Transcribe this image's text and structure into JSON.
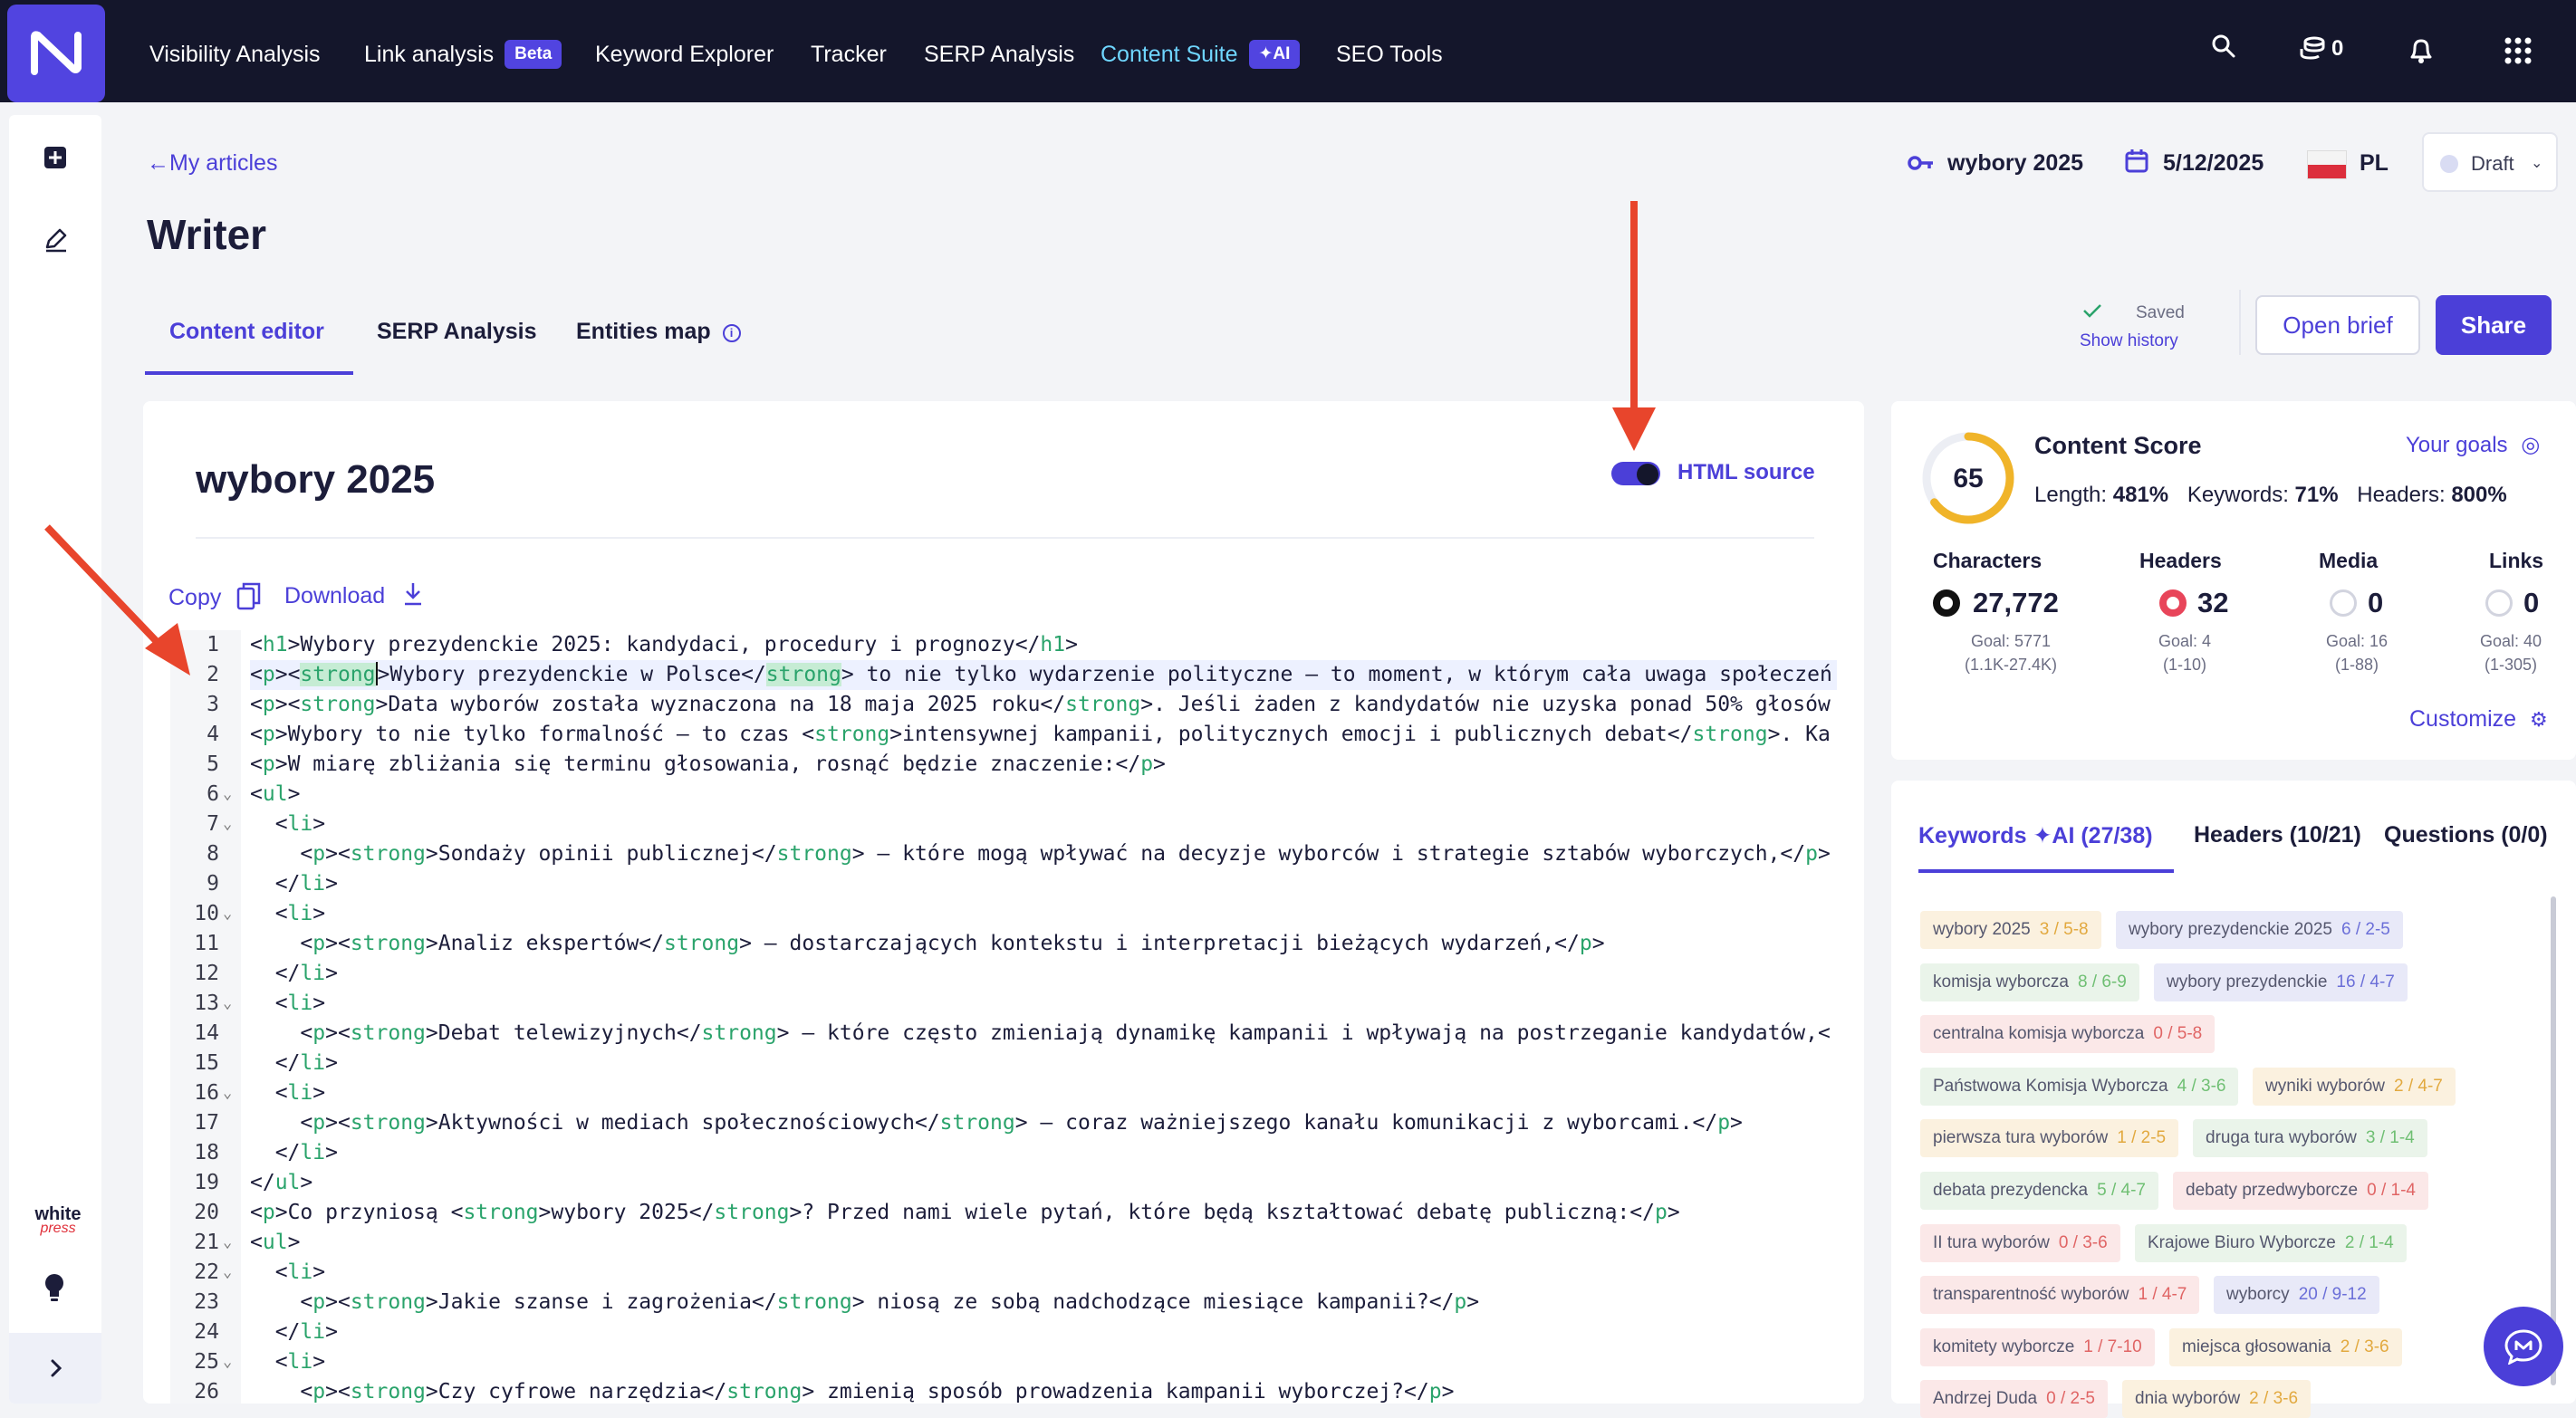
{
  "nav": {
    "items": [
      {
        "label": "Visibility Analysis"
      },
      {
        "label": "Link analysis",
        "badge": "Beta"
      },
      {
        "label": "Keyword Explorer"
      },
      {
        "label": "Tracker"
      },
      {
        "label": "SERP Analysis"
      },
      {
        "label": "Content Suite",
        "badge": "AI",
        "active": true
      },
      {
        "label": "SEO Tools"
      }
    ],
    "credits": "0",
    "icons": [
      "search-icon",
      "coins-icon",
      "bell-icon",
      "apps-grid-icon"
    ]
  },
  "sidebar": {
    "icons": [
      "add-square-icon",
      "edit-pen-icon",
      "lightbulb-icon",
      "chevron-right-icon"
    ],
    "partner_logo_top": "white",
    "partner_logo_bottom": "press"
  },
  "header": {
    "back_label": "My articles",
    "title": "Writer",
    "keyword": "wybory 2025",
    "date": "5/12/2025",
    "country": "PL",
    "status": "Draft"
  },
  "tabs": [
    {
      "label": "Content editor",
      "active": true
    },
    {
      "label": "SERP Analysis"
    },
    {
      "label": "Entities map"
    }
  ],
  "actions": {
    "saved": "Saved",
    "show_history": "Show history",
    "open_brief": "Open brief",
    "share": "Share"
  },
  "editor": {
    "doc_title": "wybory 2025",
    "html_source_label": "HTML source",
    "html_source_on": true,
    "copy_label": "Copy",
    "download_label": "Download",
    "active_line": 2,
    "lines": [
      {
        "n": "1",
        "fold": false,
        "html": "&lt;<span class='t'>h1</span>&gt;Wybory prezydenckie 2025: kandydaci, procedury i prognozy&lt;/<span class='t'>h1</span>&gt;"
      },
      {
        "n": "2",
        "fold": false,
        "html": "&lt;<span class='t'>p</span>&gt;&lt;<span class='t hl'>strong</span><span class='caret'></span>&gt;Wybory prezydenckie w Polsce&lt;/<span class='t hl'>strong</span>&gt; to nie tylko wydarzenie polityczne – to moment, w którym cała uwaga społeczeń"
      },
      {
        "n": "3",
        "fold": false,
        "html": "&lt;<span class='t'>p</span>&gt;&lt;<span class='t'>strong</span>&gt;Data wyborów została wyznaczona na 18 maja 2025 roku&lt;/<span class='t'>strong</span>&gt;. Jeśli żaden z kandydatów nie uzyska ponad 50% głosów"
      },
      {
        "n": "4",
        "fold": false,
        "html": "&lt;<span class='t'>p</span>&gt;Wybory to nie tylko formalność – to czas &lt;<span class='t'>strong</span>&gt;intensywnej kampanii, politycznych emocji i publicznych debat&lt;/<span class='t'>strong</span>&gt;. Ka"
      },
      {
        "n": "5",
        "fold": false,
        "html": "&lt;<span class='t'>p</span>&gt;W miarę zbliżania się terminu głosowania, rosnąć będzie znaczenie:&lt;/<span class='t'>p</span>&gt;"
      },
      {
        "n": "6",
        "fold": true,
        "html": "&lt;<span class='t'>ul</span>&gt;"
      },
      {
        "n": "7",
        "fold": true,
        "html": "  &lt;<span class='t'>li</span>&gt;"
      },
      {
        "n": "8",
        "fold": false,
        "html": "    &lt;<span class='t'>p</span>&gt;&lt;<span class='t'>strong</span>&gt;Sondaży opinii publicznej&lt;/<span class='t'>strong</span>&gt; – które mogą wpływać na decyzje wyborców i strategie sztabów wyborczych,&lt;/<span class='t'>p</span>&gt;"
      },
      {
        "n": "9",
        "fold": false,
        "html": "  &lt;/<span class='t'>li</span>&gt;"
      },
      {
        "n": "10",
        "fold": true,
        "html": "  &lt;<span class='t'>li</span>&gt;"
      },
      {
        "n": "11",
        "fold": false,
        "html": "    &lt;<span class='t'>p</span>&gt;&lt;<span class='t'>strong</span>&gt;Analiz ekspertów&lt;/<span class='t'>strong</span>&gt; – dostarczających kontekstu i interpretacji bieżących wydarzeń,&lt;/<span class='t'>p</span>&gt;"
      },
      {
        "n": "12",
        "fold": false,
        "html": "  &lt;/<span class='t'>li</span>&gt;"
      },
      {
        "n": "13",
        "fold": true,
        "html": "  &lt;<span class='t'>li</span>&gt;"
      },
      {
        "n": "14",
        "fold": false,
        "html": "    &lt;<span class='t'>p</span>&gt;&lt;<span class='t'>strong</span>&gt;Debat telewizyjnych&lt;/<span class='t'>strong</span>&gt; – które często zmieniają dynamikę kampanii i wpływają na postrzeganie kandydatów,&lt;"
      },
      {
        "n": "15",
        "fold": false,
        "html": "  &lt;/<span class='t'>li</span>&gt;"
      },
      {
        "n": "16",
        "fold": true,
        "html": "  &lt;<span class='t'>li</span>&gt;"
      },
      {
        "n": "17",
        "fold": false,
        "html": "    &lt;<span class='t'>p</span>&gt;&lt;<span class='t'>strong</span>&gt;Aktywności w mediach społecznościowych&lt;/<span class='t'>strong</span>&gt; – coraz ważniejszego kanału komunikacji z wyborcami.&lt;/<span class='t'>p</span>&gt;"
      },
      {
        "n": "18",
        "fold": false,
        "html": "  &lt;/<span class='t'>li</span>&gt;"
      },
      {
        "n": "19",
        "fold": false,
        "html": "&lt;/<span class='t'>ul</span>&gt;"
      },
      {
        "n": "20",
        "fold": false,
        "html": "&lt;<span class='t'>p</span>&gt;Co przyniosą &lt;<span class='t'>strong</span>&gt;wybory 2025&lt;/<span class='t'>strong</span>&gt;? Przed nami wiele pytań, które będą kształtować debatę publiczną:&lt;/<span class='t'>p</span>&gt;"
      },
      {
        "n": "21",
        "fold": true,
        "html": "&lt;<span class='t'>ul</span>&gt;"
      },
      {
        "n": "22",
        "fold": true,
        "html": "  &lt;<span class='t'>li</span>&gt;"
      },
      {
        "n": "23",
        "fold": false,
        "html": "    &lt;<span class='t'>p</span>&gt;&lt;<span class='t'>strong</span>&gt;Jakie szanse i zagrożenia&lt;/<span class='t'>strong</span>&gt; niosą ze sobą nadchodzące miesiące kampanii?&lt;/<span class='t'>p</span>&gt;"
      },
      {
        "n": "24",
        "fold": false,
        "html": "  &lt;/<span class='t'>li</span>&gt;"
      },
      {
        "n": "25",
        "fold": true,
        "html": "  &lt;<span class='t'>li</span>&gt;"
      },
      {
        "n": "26",
        "fold": false,
        "html": "    &lt;<span class='t'>p</span>&gt;&lt;<span class='t'>strong</span>&gt;Czy cyfrowe narzędzia&lt;/<span class='t'>strong</span>&gt; zmienią sposób prowadzenia kampanii wyborczej?&lt;/<span class='t'>p</span>&gt;"
      }
    ]
  },
  "score": {
    "title": "Content Score",
    "value": "65",
    "value_fraction": 0.65,
    "your_goals": "Your goals",
    "length_label": "Length:",
    "length": "481%",
    "keywords_label": "Keywords:",
    "keywords": "71%",
    "headers_label": "Headers:",
    "headers": "800%",
    "stats": [
      {
        "label": "Characters",
        "value": "27,772",
        "goal": "Goal: 5771",
        "range": "(1.1K-27.4K)",
        "status": "black"
      },
      {
        "label": "Headers",
        "value": "32",
        "goal": "Goal: 4",
        "range": "(1-10)",
        "status": "red"
      },
      {
        "label": "Media",
        "value": "0",
        "goal": "Goal: 16",
        "range": "(1-88)",
        "status": "empty"
      },
      {
        "label": "Links",
        "value": "0",
        "goal": "Goal: 40",
        "range": "(1-305)",
        "status": "empty"
      }
    ],
    "customize": "Customize"
  },
  "keywords": {
    "tabs": [
      {
        "label": "Keywords",
        "ai": "AI",
        "count": "(27/38)",
        "active": true
      },
      {
        "label": "Headers",
        "count": "(10/21)"
      },
      {
        "label": "Questions",
        "count": "(0/0)"
      }
    ],
    "chips": [
      [
        {
          "text": "wybory 2025",
          "count": "3 / 5-8",
          "tone": "y"
        },
        {
          "text": "wybory prezydenckie 2025",
          "count": "6 / 2-5",
          "tone": "b"
        }
      ],
      [
        {
          "text": "komisja wyborcza",
          "count": "8 / 6-9",
          "tone": "g"
        },
        {
          "text": "wybory prezydenckie",
          "count": "16 / 4-7",
          "tone": "b"
        }
      ],
      [
        {
          "text": "centralna komisja wyborcza",
          "count": "0 / 5-8",
          "tone": "r"
        }
      ],
      [
        {
          "text": "Państwowa Komisja Wyborcza",
          "count": "4 / 3-6",
          "tone": "g"
        },
        {
          "text": "wyniki wyborów",
          "count": "2 / 4-7",
          "tone": "y"
        }
      ],
      [
        {
          "text": "pierwsza tura wyborów",
          "count": "1 / 2-5",
          "tone": "y"
        },
        {
          "text": "druga tura wyborów",
          "count": "3 / 1-4",
          "tone": "g"
        }
      ],
      [
        {
          "text": "debata prezydencka",
          "count": "5 / 4-7",
          "tone": "g"
        },
        {
          "text": "debaty przedwyborcze",
          "count": "0 / 1-4",
          "tone": "r"
        }
      ],
      [
        {
          "text": "II tura wyborów",
          "count": "0 / 3-6",
          "tone": "r"
        },
        {
          "text": "Krajowe Biuro Wyborcze",
          "count": "2 / 1-4",
          "tone": "g"
        }
      ],
      [
        {
          "text": "transparentność wyborów",
          "count": "1 / 4-7",
          "tone": "r"
        },
        {
          "text": "wyborcy",
          "count": "20 / 9-12",
          "tone": "b"
        }
      ],
      [
        {
          "text": "komitety wyborcze",
          "count": "1 / 7-10",
          "tone": "r"
        },
        {
          "text": "miejsca głosowania",
          "count": "2 / 3-6",
          "tone": "y"
        }
      ],
      [
        {
          "text": "Andrzej Duda",
          "count": "0 / 2-5",
          "tone": "r"
        },
        {
          "text": "dnia wyborów",
          "count": "2 / 3-6",
          "tone": "y"
        }
      ]
    ]
  },
  "colors": {
    "accent": "#4b3fd8",
    "nav_bg": "#14162b",
    "logo_bg": "#5144e0",
    "nav_active": "#6fd6ff",
    "tag_green": "#2aa36b",
    "annotation_arrow": "#e8452c"
  }
}
